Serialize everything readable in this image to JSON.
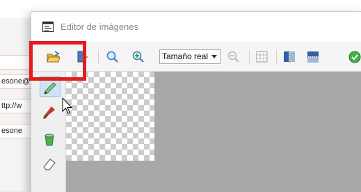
{
  "background_form": {
    "fields": [
      "esone@",
      "ttp://w",
      "esone"
    ]
  },
  "dialog": {
    "title": "Editor de imágenes"
  },
  "toolbar": {
    "zoom_value": "Tamaño real",
    "buttons": [
      "open-folder-icon",
      "export-icon",
      "zoom-out-icon",
      "zoom-in-icon",
      "zoom-fit-icon",
      "grid-icon",
      "flip-horizontal-icon",
      "flip-vertical-icon",
      "confirm-icon"
    ]
  },
  "tools": [
    "pencil-icon",
    "brush-icon",
    "fill-bucket-icon",
    "eraser-icon"
  ],
  "colors": {
    "highlight": "#e21d1d",
    "selected_tool_bg": "#cfe3f7",
    "canvas_bg": "#a8a8a8"
  }
}
